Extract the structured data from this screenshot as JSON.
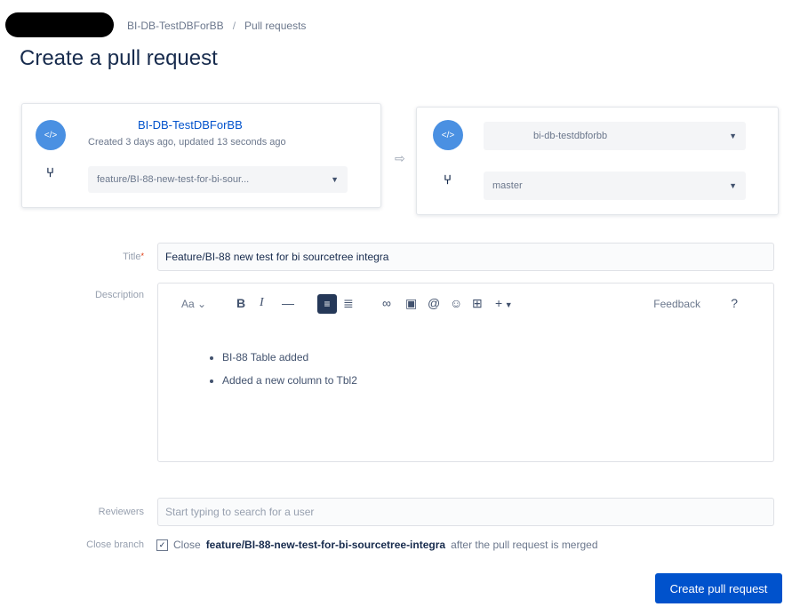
{
  "breadcrumb": {
    "repo": "BI-DB-TestDBForBB",
    "separator": "/",
    "section": "Pull requests"
  },
  "page_title": "Create a pull request",
  "source": {
    "avatar": "</>",
    "repo": "BI-DB-TestDBForBB",
    "meta": "Created 3 days ago, updated 13 seconds ago",
    "branch": "feature/BI-88-new-test-for-bi-sour..."
  },
  "destination": {
    "avatar": "</>",
    "repo": "bi-db-testdbforbb",
    "branch": "master"
  },
  "form": {
    "title_label": "Title",
    "title_required": "*",
    "title_value": "Feature/BI-88 new test for bi sourcetree integra",
    "description_label": "Description",
    "reviewers_label": "Reviewers",
    "reviewers_placeholder": "Start typing to search for a user",
    "close_branch_label": "Close branch",
    "close_text_prefix": "Close",
    "close_branch_name": "feature/BI-88-new-test-for-bi-sourcetree-integra",
    "close_text_suffix": "after the pull request is merged"
  },
  "editor": {
    "toolbar": {
      "text_style": "Aa",
      "bold": "B",
      "italic": "I",
      "more_text": "—",
      "bullet_list": "≡",
      "numbered_list": "≣",
      "link": "🔗",
      "image": "▣",
      "mention": "@",
      "emoji": "☺",
      "table": "⊞",
      "insert": "+",
      "feedback": "Feedback",
      "help": "?"
    },
    "bullets": [
      "BI-88 Table added",
      "Added a new column to Tbl2"
    ]
  },
  "buttons": {
    "create": "Create pull request"
  }
}
